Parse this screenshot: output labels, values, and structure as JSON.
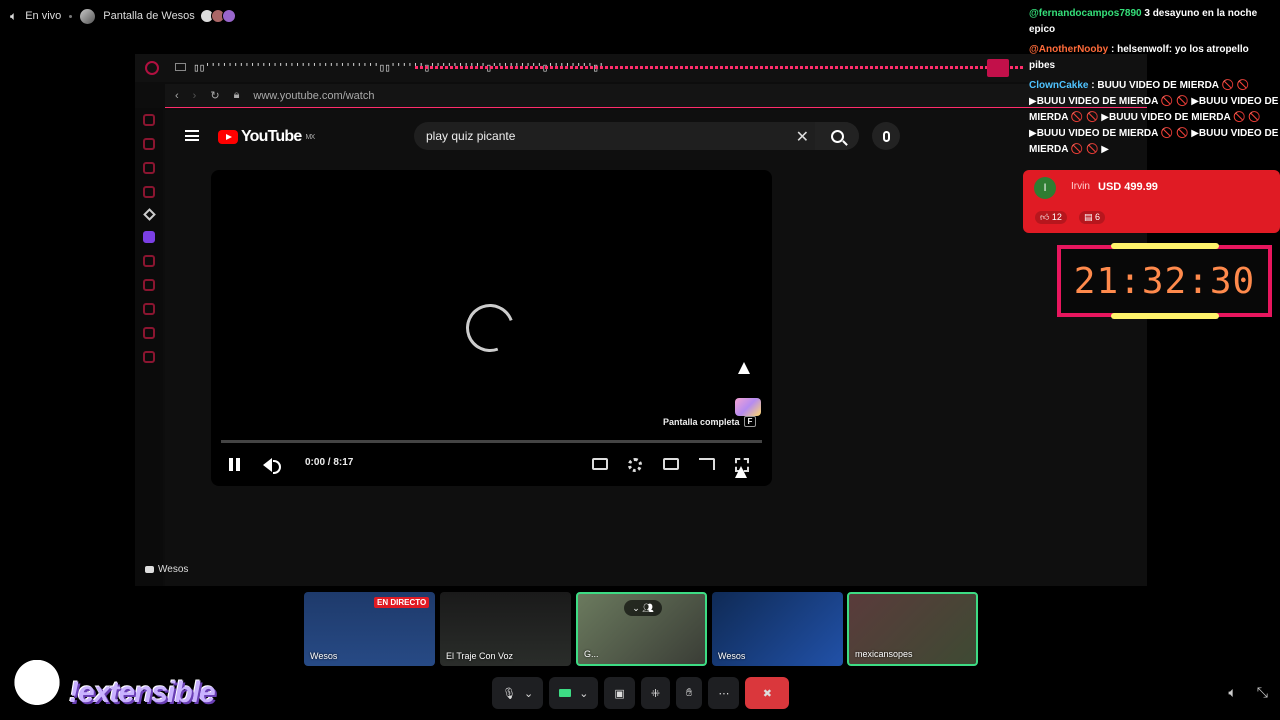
{
  "topbar": {
    "live_label": "En vivo",
    "channel_name": "Pantalla de Wesos"
  },
  "browser": {
    "tab_text": "▯▯'''''''''''''''''''''''''''''''▯▯''''''▯''''''''''▯'''''''''▯''''''''▯'",
    "url": "www.youtube.com/watch"
  },
  "youtube": {
    "logo_text": "YouTube",
    "region": "MX",
    "search_query": "play quiz picante",
    "fullscreen_tip": "Pantalla completa",
    "fullscreen_key": "F",
    "time": "0:00 / 8:17",
    "progress": 0.0
  },
  "stream_footer": {
    "label": "Wesos"
  },
  "chat": [
    {
      "user": "@fernandocampos7890",
      "text": "3 desayuno en la noche",
      "tail": "epico",
      "user_color": "#35e07a"
    },
    {
      "user": "@AnotherNooby",
      "text": ": helsenwolf: yo los atropello",
      "tail": "pibes",
      "user_color": "#ff6b3a"
    },
    {
      "user": "ClownCakke",
      "text": ": BUUU VIDEO DE MIERDA 🚫 🚫 ▶BUUU VIDEO DE MIERDA 🚫 🚫 ▶BUUU VIDEO DE MIERDA 🚫 🚫 ▶BUUU VIDEO DE MIERDA 🚫 🚫 ▶BUUU VIDEO DE MIERDA 🚫 🚫 ▶BUUU VIDEO DE MIERDA 🚫 🚫 ▶",
      "user_color": "#4fc3ff"
    }
  ],
  "superchat": {
    "avatar_letter": "I",
    "name": "Irvin",
    "amount": "USD 499.99",
    "likes": "12",
    "replies": "6",
    "color": "#e01b24"
  },
  "clock": {
    "time": "21:32:30"
  },
  "participants": [
    {
      "name": "Wesos",
      "badge": "EN DIRECTO"
    },
    {
      "name": "El Traje Con Voz"
    },
    {
      "name": "G..."
    },
    {
      "name": "Wesos"
    },
    {
      "name": "mexicansopes"
    }
  ],
  "brand": {
    "text": "!extensible"
  },
  "colors": {
    "accent_pink": "#e8165e",
    "clock_digits": "#ff8a4c",
    "speaking_border": "#3ddc84",
    "end_call": "#da373c"
  }
}
